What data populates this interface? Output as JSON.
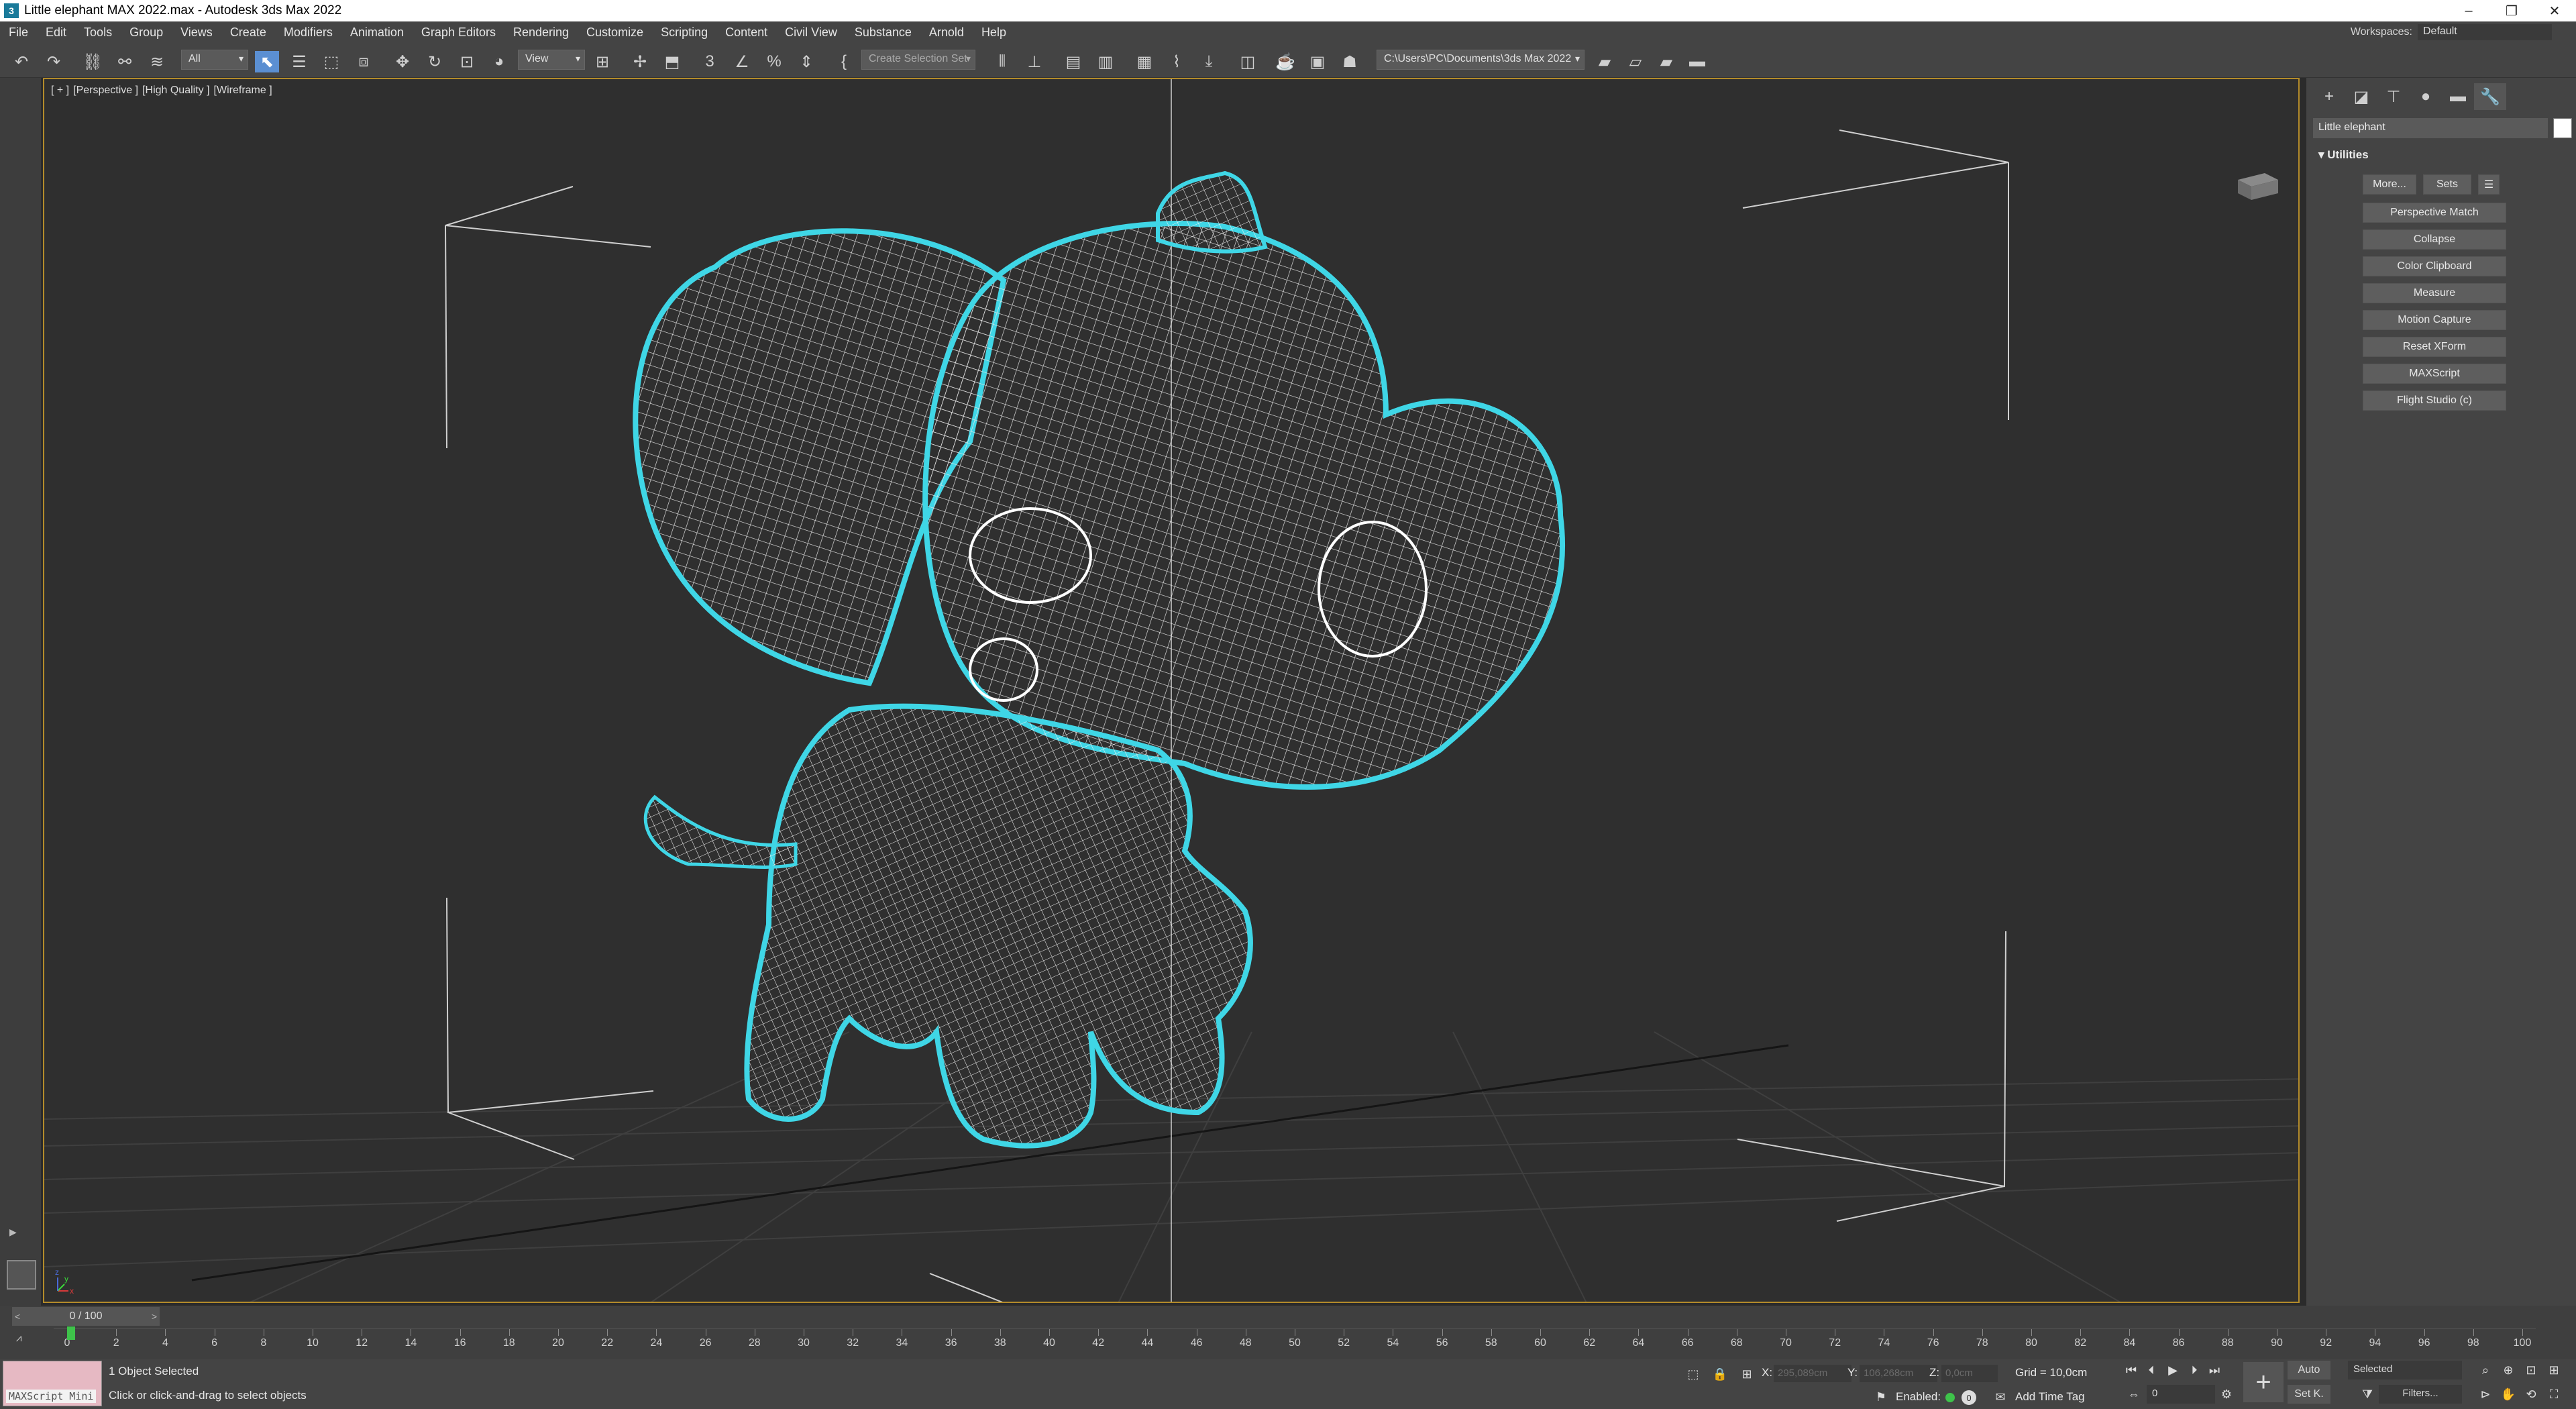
{
  "window": {
    "title": "Little elephant MAX 2022.max - Autodesk 3ds Max 2022",
    "app_icon": "3",
    "controls": {
      "minimize": "–",
      "restore": "❐",
      "close": "✕"
    }
  },
  "menu": {
    "items": [
      "File",
      "Edit",
      "Tools",
      "Group",
      "Views",
      "Create",
      "Modifiers",
      "Animation",
      "Graph Editors",
      "Rendering",
      "Customize",
      "Scripting",
      "Content",
      "Civil View",
      "Substance",
      "Arnold",
      "Help"
    ],
    "workspaces_label": "Workspaces:",
    "workspace_value": "Default"
  },
  "toolbar": {
    "selection_filter": "All",
    "reference_coord": "View",
    "selection_set_placeholder": "Create Selection Set",
    "project_path": "C:\\Users\\PC\\Documents\\3ds Max 2022",
    "snaps_label": "3"
  },
  "viewport": {
    "labels": [
      "[ + ]",
      "[Perspective ]",
      "[High Quality ]",
      "[Wireframe ]"
    ],
    "selection_color": "#3fd6e6",
    "wire_color": "#ffffff",
    "axis_labels": {
      "x": "x",
      "y": "y",
      "z": "z"
    }
  },
  "command_panel": {
    "object_name": "Little elephant",
    "rollout_title": "Utilities",
    "top_buttons": {
      "more": "More...",
      "sets": "Sets"
    },
    "utility_buttons": [
      "Perspective Match",
      "Collapse",
      "Color Clipboard",
      "Measure",
      "Motion Capture",
      "Reset XForm",
      "MAXScript",
      "Flight Studio (c)"
    ]
  },
  "timeline": {
    "frame_display": "0 / 100",
    "ruler_labels": [
      0,
      2,
      4,
      6,
      8,
      10,
      12,
      14,
      16,
      18,
      20,
      22,
      24,
      26,
      28,
      30,
      32,
      34,
      36,
      38,
      40,
      42,
      44,
      46,
      48,
      50,
      52,
      54,
      56,
      58,
      60,
      62,
      64,
      66,
      68,
      70,
      72,
      74,
      76,
      78,
      80,
      82,
      84,
      86,
      88,
      90,
      92,
      94,
      96,
      98,
      100
    ]
  },
  "status": {
    "maxscript_label": "MAXScript Mini",
    "selected_text": "1 Object Selected",
    "prompt_text": "Click or click-and-drag to select objects",
    "coords": {
      "x_label": "X:",
      "x_value": "295,089cm",
      "y_label": "Y:",
      "y_value": "106,268cm",
      "z_label": "Z:",
      "z_value": "0,0cm"
    },
    "grid": "Grid = 10,0cm",
    "enabled_label": "Enabled:",
    "add_time_tag": "Add Time Tag",
    "auto_label": "Auto",
    "setkey_label": "Set K.",
    "selected_dropdown": "Selected",
    "filters_label": "Filters...",
    "frame_field": "0"
  }
}
